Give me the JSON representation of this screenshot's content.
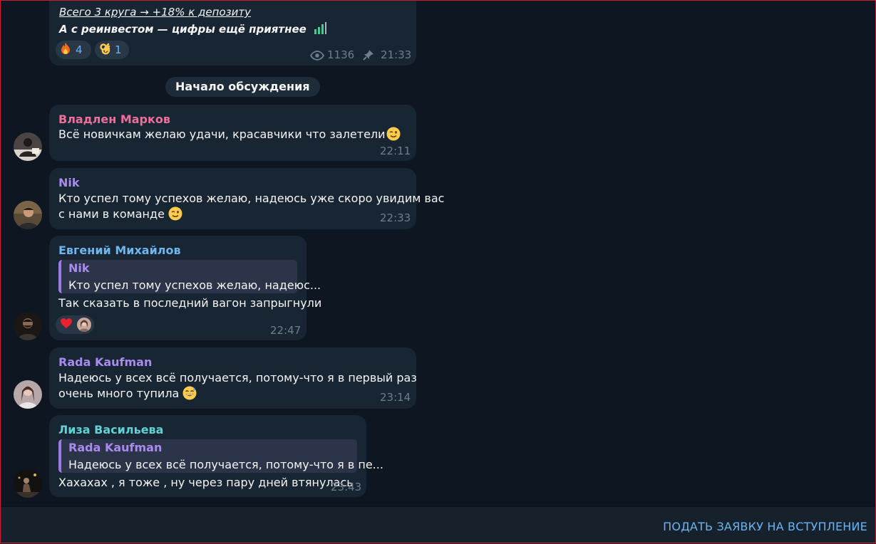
{
  "channel_post": {
    "line1": "Всего 3 круга → +18% к депозиту",
    "line2": "А с реинвестом — цифры ещё приятнее",
    "reactions": [
      {
        "emoji": "fire",
        "count": "4"
      },
      {
        "emoji": "ok-hand",
        "count": "1"
      }
    ],
    "views": "1136",
    "time": "21:33"
  },
  "discussion_start": "Начало обсуждения",
  "messages": [
    {
      "author": "Владлен Марков",
      "author_color": "#ee6f9a",
      "lines": [
        "Всё новичкам желаю удачи, красавчики что залетели"
      ],
      "time": "22:11"
    },
    {
      "author": "Nik",
      "author_color": "#a98bf0",
      "lines": [
        "Кто успел тому успехов желаю, надеюсь уже скоро увидим вас",
        "с нами в команде"
      ],
      "time": "22:33"
    },
    {
      "author": "Евгений Михайлов",
      "author_color": "#6fb5ee",
      "quote": {
        "author": "Nik",
        "text": "Кто успел тому успехов желаю, надеюс..."
      },
      "lines": [
        "Так сказать в последний вагон запрыгнули"
      ],
      "time": "22:47"
    },
    {
      "author": "Rada Kaufman",
      "author_color": "#a98bf0",
      "lines": [
        "Надеюсь у всех всё получается, потому-что я в первый раз",
        "очень много тупила"
      ],
      "time": "23:14"
    },
    {
      "author": "Лиза Васильева",
      "author_color": "#5fd2d6",
      "quote": {
        "author": "Rada Kaufman",
        "text": "Надеюсь у всех всё получается, потому-что я в пе..."
      },
      "lines": [
        "Хахахах , я тоже , ну через пару дней втянулась"
      ],
      "time": "23:43"
    }
  ],
  "bottom_bar": {
    "join_label": "ПОДАТЬ ЗАЯВКУ НА ВСТУПЛЕНИЕ"
  }
}
